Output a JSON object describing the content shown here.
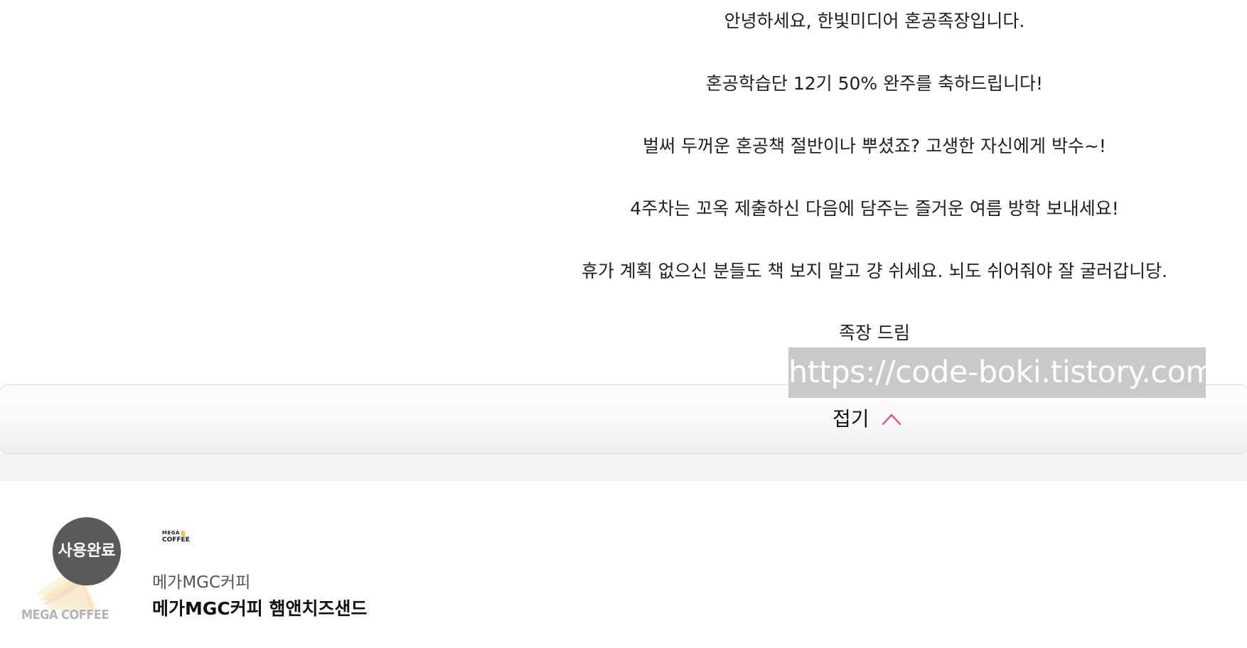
{
  "message": {
    "lines": [
      "안녕하세요, 한빛미디어 혼공족장입니다.",
      "혼공학습단 12기 50% 완주를 축하드립니다!",
      "벌써 두꺼운 혼공책 절반이나 뿌셨죠? 고생한 자신에게 박수~!",
      "4주차는 꼬옥 제출하신 다음에 담주는 즐거운 여름 방학 보내세요!",
      "휴가 계획 없으신 분들도 책 보지 말고 걍 쉬세요. 뇌도 쉬어줘야 잘 굴러갑니당.",
      "족장 드림"
    ]
  },
  "watermark": {
    "text": "https://code-boki.tistory.com"
  },
  "collapse": {
    "label": "접기",
    "icon": "chevron-up-icon",
    "icon_color": "#e8467c"
  },
  "coupon": {
    "status_badge": "사용완료",
    "thumbnail_brand": "MEGA COFFEE",
    "logo_text_top": "MEGA",
    "logo_text_bottom": "COFFEE",
    "brand": "메가MGC커피",
    "product": "메가MGC커피 햄앤치즈샌드"
  },
  "colors": {
    "badge_bg": "#5a5a58",
    "band_bg": "#f3f3f3",
    "watermark_bg": "#c9c9c9"
  }
}
